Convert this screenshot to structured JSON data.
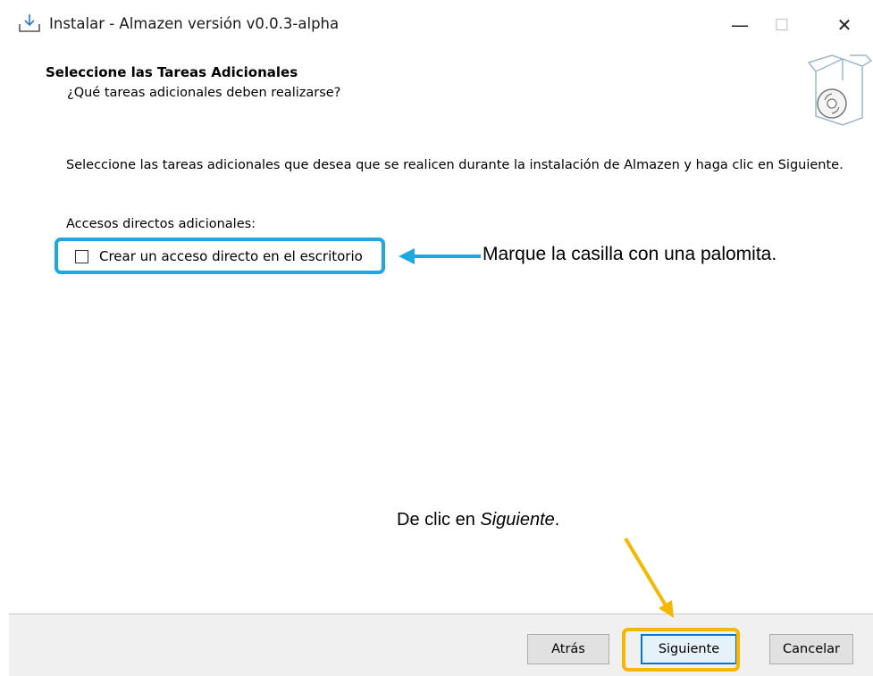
{
  "window": {
    "title": "Instalar - Almazen versión v0.0.3-alpha",
    "controls": {
      "minimize": "—",
      "maximize": "☐",
      "close": "✕"
    }
  },
  "header": {
    "title": "Seleccione las Tareas Adicionales",
    "subtitle": "¿Qué tareas adicionales deben realizarse?",
    "logo_icon": "installer-box-cd-icon"
  },
  "content": {
    "description": "Seleccione las tareas adicionales que desea que se realicen durante la instalación de Almazen y haga clic en Siguiente.",
    "section_label": "Accesos directos adicionales:",
    "tasks": [
      {
        "label": "Crear un acceso directo en el escritorio",
        "checked": false
      }
    ]
  },
  "buttons": {
    "back": "Atrás",
    "next": "Siguiente",
    "cancel": "Cancelar"
  },
  "annotations": {
    "checkbox_hint": "Marque la casilla con una palomita.",
    "next_hint_prefix": "De clic en ",
    "next_hint_emphasis": "Siguiente",
    "next_hint_suffix": ".",
    "colors": {
      "blue": "#1ea7e1",
      "yellow": "#f5b700"
    }
  }
}
